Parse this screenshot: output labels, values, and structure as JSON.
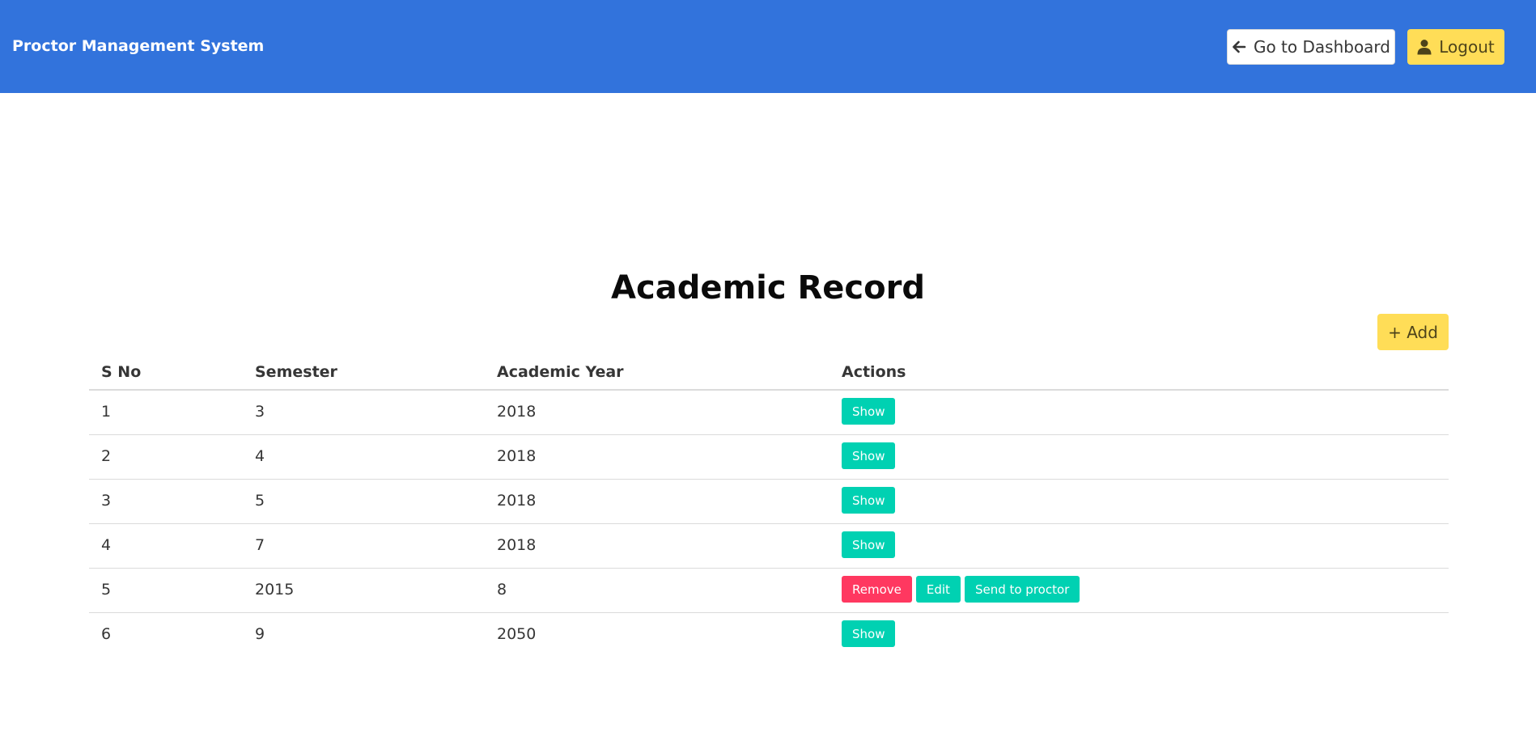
{
  "navbar": {
    "brand": "Proctor Management System",
    "dashboard_label": "Go to Dashboard",
    "logout_label": "Logout",
    "color": "#3273dc"
  },
  "page": {
    "title": "Academic Record",
    "add_label": "+ Add"
  },
  "table": {
    "headers": [
      "S No",
      "Semester",
      "Academic Year",
      "Actions"
    ],
    "rows": [
      {
        "sno": "1",
        "semester": "3",
        "year": "2018",
        "actions": [
          "Show"
        ]
      },
      {
        "sno": "2",
        "semester": "4",
        "year": "2018",
        "actions": [
          "Show"
        ]
      },
      {
        "sno": "3",
        "semester": "5",
        "year": "2018",
        "actions": [
          "Show"
        ]
      },
      {
        "sno": "4",
        "semester": "7",
        "year": "2018",
        "actions": [
          "Show"
        ]
      },
      {
        "sno": "5",
        "semester": "2015",
        "year": "8",
        "actions": [
          "Remove",
          "Edit",
          "Send to proctor"
        ]
      },
      {
        "sno": "6",
        "semester": "9",
        "year": "2050",
        "actions": [
          "Show"
        ]
      }
    ]
  },
  "colors": {
    "primary": "#00d1b2",
    "danger": "#ff3860",
    "warning": "#ffdd57"
  },
  "icons": {
    "dashboard": "arrow-left-icon",
    "logout": "user-icon"
  }
}
